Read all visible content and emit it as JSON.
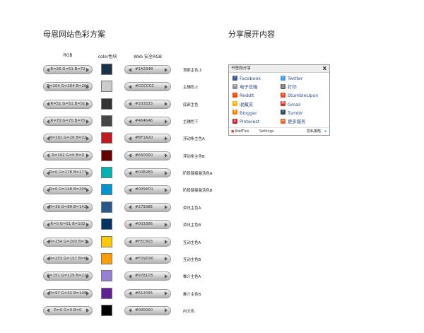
{
  "left_title": "母恩网站色彩方案",
  "right_title": "分享展开内容",
  "columns": {
    "rgb": "RGB",
    "swatch": "color色块",
    "web": "Web 安全RGB"
  },
  "rows": [
    {
      "rgb": "R=26 G=51 B=72",
      "hex": "#1A3348",
      "color": "#1A3348",
      "desc": "顶部主色上"
    },
    {
      "rgb": "R=204 G=204 B=204",
      "hex": "#CCCCCC",
      "color": "#CCCCCC",
      "desc": "主辅色上"
    },
    {
      "rgb": "R=51 G=51 B=51",
      "hex": "#333333",
      "color": "#333333",
      "desc": "底部主色"
    },
    {
      "rgb": "R=70 G=70 B=70",
      "hex": "#464646",
      "color": "#464646",
      "desc": "主辅色下"
    },
    {
      "rgb": "R=191 G=26 B=32",
      "hex": "#BF1A20",
      "color": "#BF1A20",
      "desc": "浮动条主色A"
    },
    {
      "rgb": "R=102 G=0 B=0",
      "hex": "#660000",
      "color": "#660000",
      "desc": "浮动条主色B"
    },
    {
      "rgb": "R=0 G=178 B=177",
      "hex": "#00B2B1",
      "color": "#00B2B1",
      "desc": "阶段链接激活色A"
    },
    {
      "rgb": "R=0 G=148 B=209",
      "hex": "#0094D1",
      "color": "#0094D1",
      "desc": "阶段链接激活色B"
    },
    {
      "rgb": "R=39 G=89 B=142",
      "hex": "#27598E",
      "color": "#27598E",
      "desc": "资讯主色A"
    },
    {
      "rgb": "R=0 G=51 B=102",
      "hex": "#003366",
      "color": "#003366",
      "desc": "资讯主色B"
    },
    {
      "rgb": "R=254 G=200 B=3",
      "hex": "#FEC803",
      "color": "#FEC803",
      "desc": "互动主色A"
    },
    {
      "rgb": "R=253 G=157 B=0",
      "hex": "#FD9D00",
      "color": "#FD9D00",
      "desc": "互动主色B"
    },
    {
      "rgb": "R=151 G=129 B=213",
      "hex": "#9781D5",
      "color": "#9781D5",
      "desc": "推介主色A"
    },
    {
      "rgb": "R=97 G=32 B=149",
      "hex": "#612095",
      "color": "#612095",
      "desc": "推介主色B"
    },
    {
      "rgb": "R=0 G=0 B=0",
      "hex": "#000000",
      "color": "#000000",
      "desc": "内文色"
    }
  ],
  "share_panel": {
    "header": "书签和分享",
    "close": "X",
    "services": [
      {
        "label": "Facebook",
        "icon": "facebook-icon",
        "color": "#3b5998",
        "glyph": "f"
      },
      {
        "label": "Twitter",
        "icon": "twitter-icon",
        "color": "#4099ff",
        "glyph": "t"
      },
      {
        "label": "电子信箱",
        "icon": "email-icon",
        "color": "#8a8a8a",
        "glyph": "✉"
      },
      {
        "label": "打印",
        "icon": "print-icon",
        "color": "#5a5a5a",
        "glyph": "⎙"
      },
      {
        "label": "Reddit",
        "icon": "reddit-icon",
        "color": "#ff4500",
        "glyph": "r"
      },
      {
        "label": "StumbleUpon",
        "icon": "stumbleupon-icon",
        "color": "#eb4924",
        "glyph": "s"
      },
      {
        "label": "收藏夹",
        "icon": "favorites-icon",
        "color": "#f5b400",
        "glyph": "★"
      },
      {
        "label": "Gmail",
        "icon": "gmail-icon",
        "color": "#d93025",
        "glyph": "M"
      },
      {
        "label": "Blogger",
        "icon": "blogger-icon",
        "color": "#f57d00",
        "glyph": "B"
      },
      {
        "label": "Tumblr",
        "icon": "tumblr-icon",
        "color": "#35465c",
        "glyph": "t"
      },
      {
        "label": "Pinterest",
        "icon": "pinterest-icon",
        "color": "#cb2027",
        "glyph": "p"
      },
      {
        "label": "更多服务",
        "icon": "more-services-icon",
        "color": "#e86a2b",
        "glyph": "+"
      }
    ],
    "footer": {
      "addthis": "AddThis",
      "settings": "Settings",
      "privacy": "隐私策略"
    }
  }
}
